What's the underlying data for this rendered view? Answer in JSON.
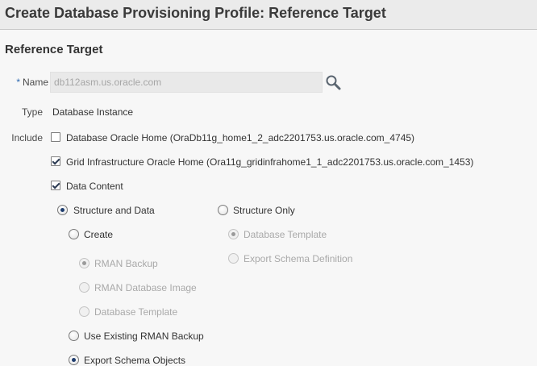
{
  "header": {
    "title": "Create Database Provisioning Profile: Reference Target"
  },
  "section": {
    "title": "Reference Target"
  },
  "name": {
    "required_mark": "*",
    "label": "Name",
    "value": "db112asm.us.oracle.com",
    "search_icon": "search-icon"
  },
  "type": {
    "label": "Type",
    "value": "Database Instance"
  },
  "include": {
    "label": "Include",
    "options": [
      {
        "label": "Database Oracle Home (OraDb11g_home1_2_adc2201753.us.oracle.com_4745)",
        "checked": false
      },
      {
        "label": "Grid Infrastructure Oracle Home (Ora11g_gridinfrahome1_1_adc2201753.us.oracle.com_1453)",
        "checked": true
      },
      {
        "label": "Data Content",
        "checked": true
      }
    ]
  },
  "data_content": {
    "structure_and_data": {
      "label": "Structure and Data",
      "selected": true
    },
    "structure_only": {
      "label": "Structure Only",
      "selected": false
    },
    "create": {
      "label": "Create",
      "selected": false
    },
    "create_options": [
      {
        "label": "RMAN Backup",
        "selected": true,
        "disabled": true
      },
      {
        "label": "RMAN Database Image",
        "selected": false,
        "disabled": true
      },
      {
        "label": "Database Template",
        "selected": false,
        "disabled": true
      }
    ],
    "use_existing": {
      "label": "Use Existing RMAN Backup",
      "selected": false
    },
    "export_schema_objects": {
      "label": "Export Schema Objects",
      "selected": true
    },
    "structure_only_options": [
      {
        "label": "Database Template",
        "selected": true,
        "disabled": true
      },
      {
        "label": "Export Schema Definition",
        "selected": false,
        "disabled": true
      }
    ]
  }
}
